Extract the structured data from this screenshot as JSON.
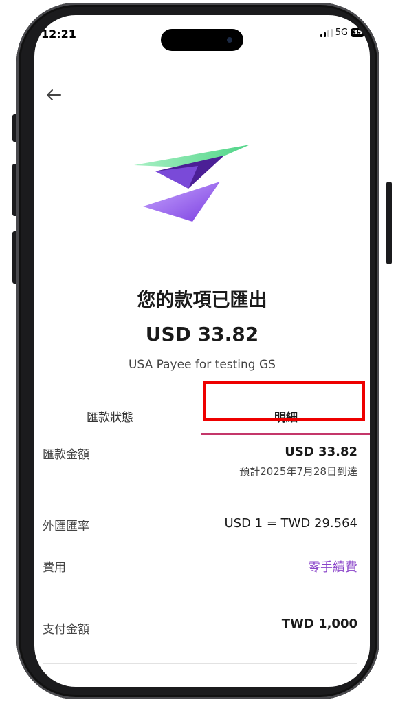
{
  "status_bar": {
    "time": "12:21",
    "network": "5G",
    "battery": "35"
  },
  "header": {
    "back_icon": "arrow-left-icon"
  },
  "hero": {
    "logo_icon": "paper-plane-logo-icon",
    "colors": {
      "green": "#5fd89a",
      "purple": "#8a4ee8"
    }
  },
  "summary": {
    "title": "您的款項已匯出",
    "amount": "USD 33.82",
    "payee": "USA Payee for testing GS"
  },
  "tabs": [
    {
      "label": "匯款狀態",
      "active": false
    },
    {
      "label": "明細",
      "active": true
    }
  ],
  "details": {
    "transfer_amount": {
      "label": "匯款金額",
      "value": "USD 33.82",
      "note": "預計2025年7月28日到達"
    },
    "fx_rate": {
      "label": "外匯匯率",
      "value": "USD 1 = TWD 29.564"
    },
    "fees": {
      "label": "費用",
      "value": "零手續費"
    },
    "payment_amount": {
      "label": "支付金額",
      "value": "TWD 1,000"
    }
  },
  "colors": {
    "accent_fee": "#8a44c9",
    "tab_indicator": "#c4366a",
    "highlight": "#ee0000"
  }
}
